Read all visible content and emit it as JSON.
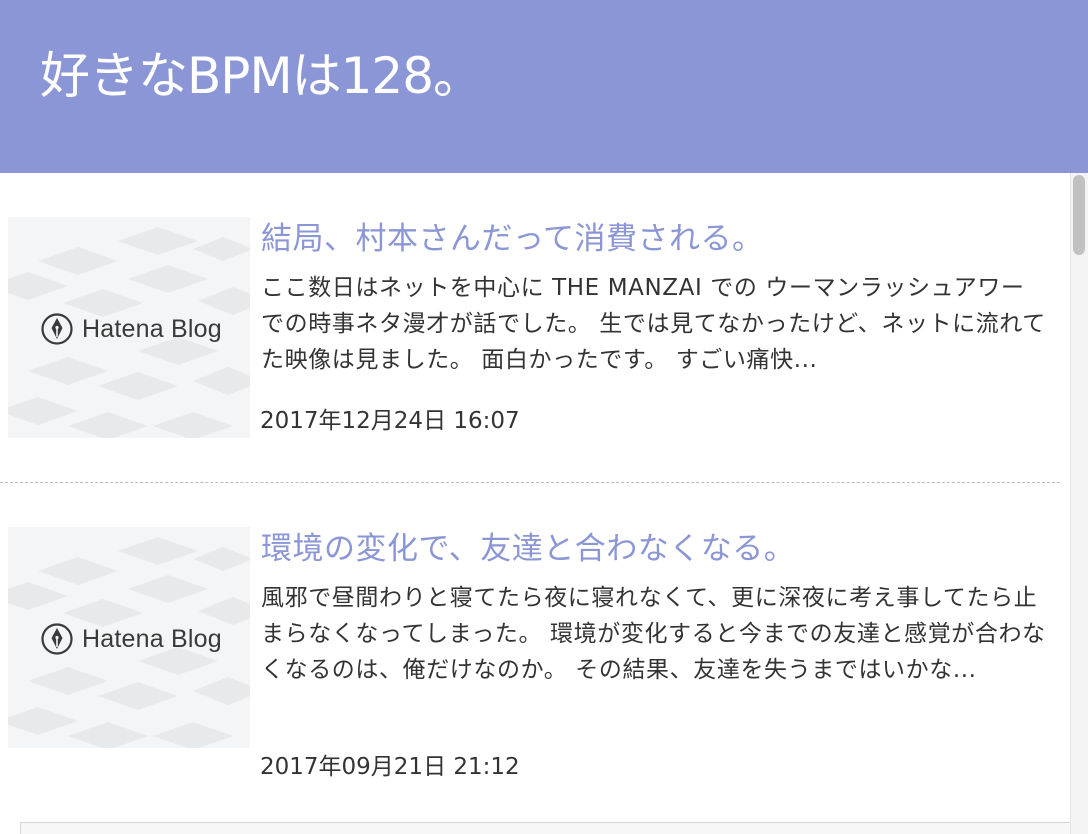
{
  "blog": {
    "title": "好きなBPMは128。"
  },
  "colors": {
    "header_bg": "#8b96d6",
    "accent": "#8b96d6",
    "text": "#333333"
  },
  "entries": [
    {
      "thumbnail_alt": "Hatena Blog",
      "title": "結局、村本さんだって消費される。",
      "summary": "ここ数日はネットを中心に THE MANZAI での ウーマンラッシュアワー での時事ネタ漫才が話でした。 生では見てなかったけど、ネットに流れてた映像は見ました。 面白かったです。 すごい痛快...",
      "date": "2017年12月24日 16:07"
    },
    {
      "thumbnail_alt": "Hatena Blog",
      "title": "環境の変化で、友達と合わなくなる。",
      "summary": "風邪で昼間わりと寝てたら夜に寝れなくて、更に深夜に考え事してたら止まらなくなってしまった。 環境が変化すると今までの友達と感覚が合わなくなるのは、俺だけなのか。 その結果、友達を失うまではいかな...",
      "date": "2017年09月21日 21:12"
    }
  ],
  "icons": {
    "thumbnail_logo": "hatena-blog-pen-icon"
  }
}
